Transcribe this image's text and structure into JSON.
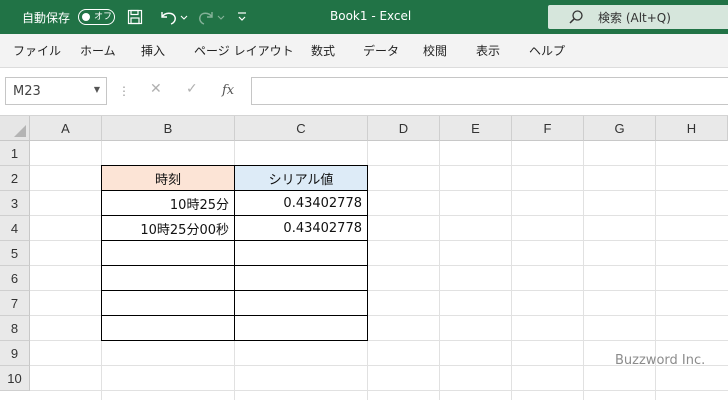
{
  "titlebar": {
    "autosave_label": "自動保存",
    "autosave_state": "オフ",
    "window_title": "Book1  -  Excel",
    "search_placeholder": "検索 (Alt+Q)"
  },
  "ribbon": {
    "tabs": [
      "ファイル",
      "ホーム",
      "挿入",
      "ページ レイアウト",
      "数式",
      "データ",
      "校閲",
      "表示",
      "ヘルプ"
    ]
  },
  "formula_bar": {
    "name_box": "M23",
    "fx_label": "fx",
    "content": ""
  },
  "sheet": {
    "columns": [
      "A",
      "B",
      "C",
      "D",
      "E",
      "F",
      "G",
      "H"
    ],
    "rows": [
      "1",
      "2",
      "3",
      "4",
      "5",
      "6",
      "7",
      "8",
      "9",
      "10"
    ],
    "table": {
      "header_b": "時刻",
      "header_c": "シリアル値",
      "r3_b": "10時25分",
      "r3_c": "0.43402778",
      "r4_b": "10時25分00秒",
      "r4_c": "0.43402778"
    },
    "header_colors": {
      "b": "#fce4d6",
      "c": "#ddebf7"
    }
  },
  "watermark": "Buzzword Inc.",
  "colors": {
    "title_bar": "#217346",
    "ribbon": "#f3f3f3"
  },
  "icons": [
    "save-icon",
    "undo-icon",
    "redo-icon",
    "customize-icon",
    "search-icon",
    "cancel-icon",
    "enter-icon"
  ]
}
